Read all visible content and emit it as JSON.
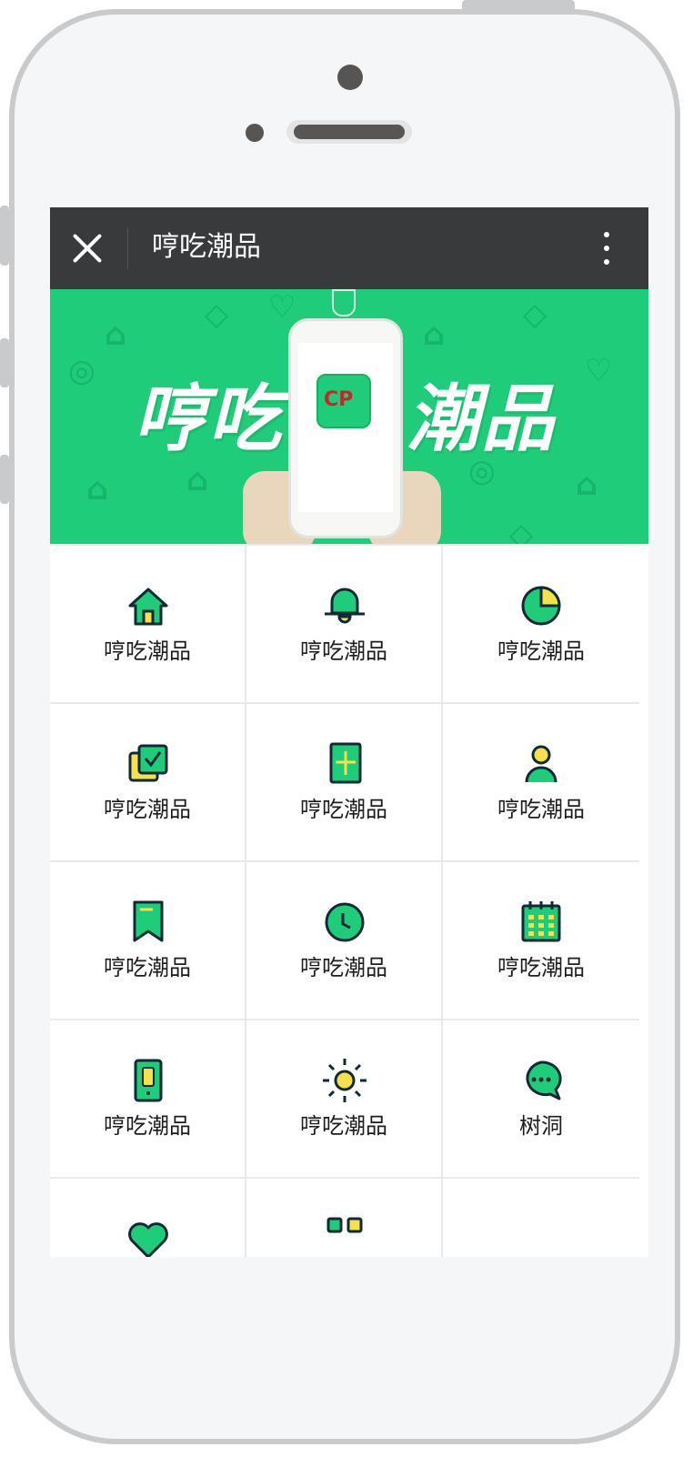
{
  "window": {
    "title": "哼吃潮品"
  },
  "banner": {
    "left_text": "哼吃",
    "right_text": "潮品",
    "logo_text": "CP",
    "colors": {
      "bg": "#1fcc79",
      "pattern": "#15b56a"
    }
  },
  "grid": {
    "items": [
      {
        "label": "哼吃潮品",
        "icon": "home-icon"
      },
      {
        "label": "哼吃潮品",
        "icon": "bell-icon"
      },
      {
        "label": "哼吃潮品",
        "icon": "pie-chart-icon"
      },
      {
        "label": "哼吃潮品",
        "icon": "checkbox-icon"
      },
      {
        "label": "哼吃潮品",
        "icon": "document-add-icon"
      },
      {
        "label": "哼吃潮品",
        "icon": "user-icon"
      },
      {
        "label": "哼吃潮品",
        "icon": "bookmark-icon"
      },
      {
        "label": "哼吃潮品",
        "icon": "clock-icon"
      },
      {
        "label": "哼吃潮品",
        "icon": "calendar-icon"
      },
      {
        "label": "哼吃潮品",
        "icon": "mobile-icon"
      },
      {
        "label": "哼吃潮品",
        "icon": "sun-icon"
      },
      {
        "label": "树洞",
        "icon": "chat-icon"
      },
      {
        "label": "",
        "icon": "heart-icon"
      },
      {
        "label": "",
        "icon": "grid-icon"
      },
      {
        "label": "",
        "icon": ""
      }
    ]
  },
  "colors": {
    "accent": "#1fcc79",
    "icon_stroke": "#0f2a36",
    "icon_yellow": "#f7e14a",
    "topbar": "#393a3c"
  }
}
